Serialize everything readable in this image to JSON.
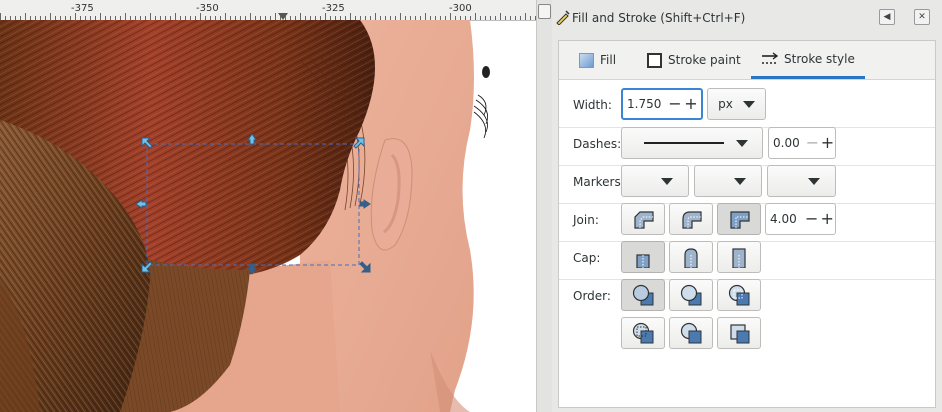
{
  "ruler": {
    "labels": [
      "-375",
      "-350",
      "-325",
      "-300"
    ]
  },
  "dialog": {
    "title": "Fill and Stroke (Shift+Ctrl+F)",
    "tabs": [
      {
        "label": "Fill",
        "active": false
      },
      {
        "label": "Stroke paint",
        "active": false
      },
      {
        "label": "Stroke style",
        "active": true
      }
    ],
    "width": {
      "label": "Width:",
      "value": "1.750",
      "unit": "px"
    },
    "dashes": {
      "label": "Dashes:",
      "offset": "0.00"
    },
    "markers": {
      "label": "Markers:"
    },
    "join": {
      "label": "Join:",
      "miter_limit": "4.00",
      "selected": "miter"
    },
    "cap": {
      "label": "Cap:",
      "selected": "butt"
    },
    "order": {
      "label": "Order:",
      "selected": "fill-stroke-markers"
    }
  },
  "colors": {
    "accent": "#2a76c6",
    "skin": "#e8ab93",
    "hair_dark": "#5a2a12",
    "hair_red": "#a33b22"
  }
}
